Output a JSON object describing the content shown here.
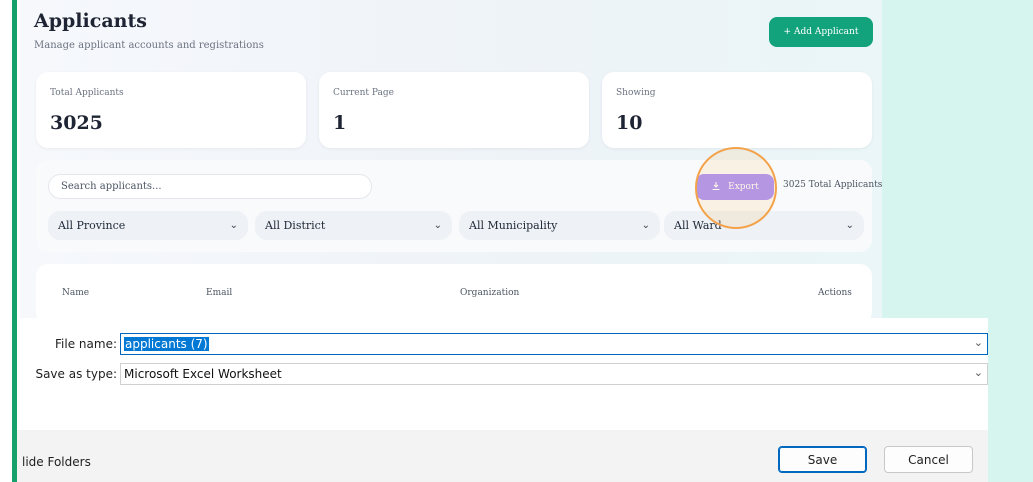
{
  "app": {
    "title": "Applicants",
    "subtitle": "Manage applicant accounts and registrations",
    "add_button": "+ Add Applicant",
    "stats": [
      {
        "label": "Total Applicants",
        "value": "3025"
      },
      {
        "label": "Current Page",
        "value": "1"
      },
      {
        "label": "Showing",
        "value": "10"
      }
    ],
    "filters": {
      "search_placeholder": "Search applicants...",
      "export_label": "Export",
      "total_text": "3025 Total Applicants",
      "selects": [
        "All Province",
        "All District",
        "All Municipality",
        "All Ward"
      ]
    },
    "table": {
      "headers": [
        "Name",
        "Email",
        "Organization",
        "Actions"
      ]
    }
  },
  "dialog": {
    "file_name_label": "File name:",
    "file_name_value": "applicants (7)",
    "save_type_label": "Save as type:",
    "save_type_value": "Microsoft Excel Worksheet",
    "hide_folders": "lide Folders",
    "save_button": "Save",
    "cancel_button": "Cancel"
  },
  "colors": {
    "accent_green": "#13a37c",
    "export_purple": "#a78bfa",
    "highlight_orange": "#f4a24a",
    "dialog_blue": "#0078d4"
  }
}
